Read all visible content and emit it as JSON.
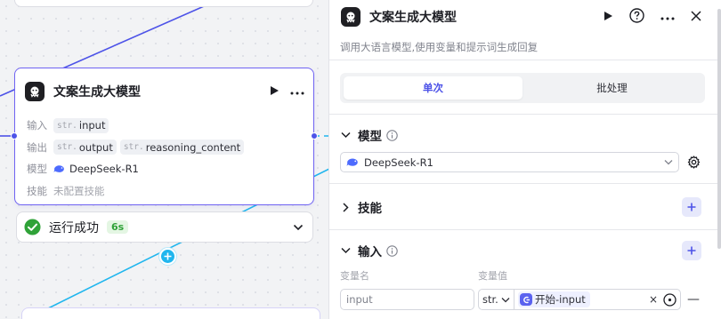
{
  "colors": {
    "accent": "#4d53e8",
    "success": "#2fa238",
    "edge_blue": "#20b6ee",
    "edge_indigo": "#4d53e8"
  },
  "node": {
    "title": "文案生成大模型",
    "rows": {
      "input_label": "输入",
      "input_tags": [
        {
          "type": "str.",
          "name": "input"
        }
      ],
      "output_label": "输出",
      "output_tags": [
        {
          "type": "str.",
          "name": "output"
        },
        {
          "type": "str.",
          "name": "reasoning_content"
        }
      ],
      "model_label": "模型",
      "model_value": "DeepSeek-R1",
      "skill_label": "技能",
      "skill_value": "未配置技能"
    },
    "status": {
      "text": "运行成功",
      "duration": "6s"
    }
  },
  "panel": {
    "title": "文案生成大模型",
    "description": "调用大语言模型,使用变量和提示词生成回复",
    "tabs": [
      "单次",
      "批处理"
    ],
    "model_section": {
      "title": "模型",
      "selected": "DeepSeek-R1"
    },
    "skills_section": {
      "title": "技能"
    },
    "input_section": {
      "title": "输入",
      "col_name": "变量名",
      "col_value": "变量值",
      "row": {
        "name": "input",
        "type": "str.",
        "ref_node": "开始",
        "ref_sep": " - ",
        "ref_var": "input"
      }
    }
  }
}
